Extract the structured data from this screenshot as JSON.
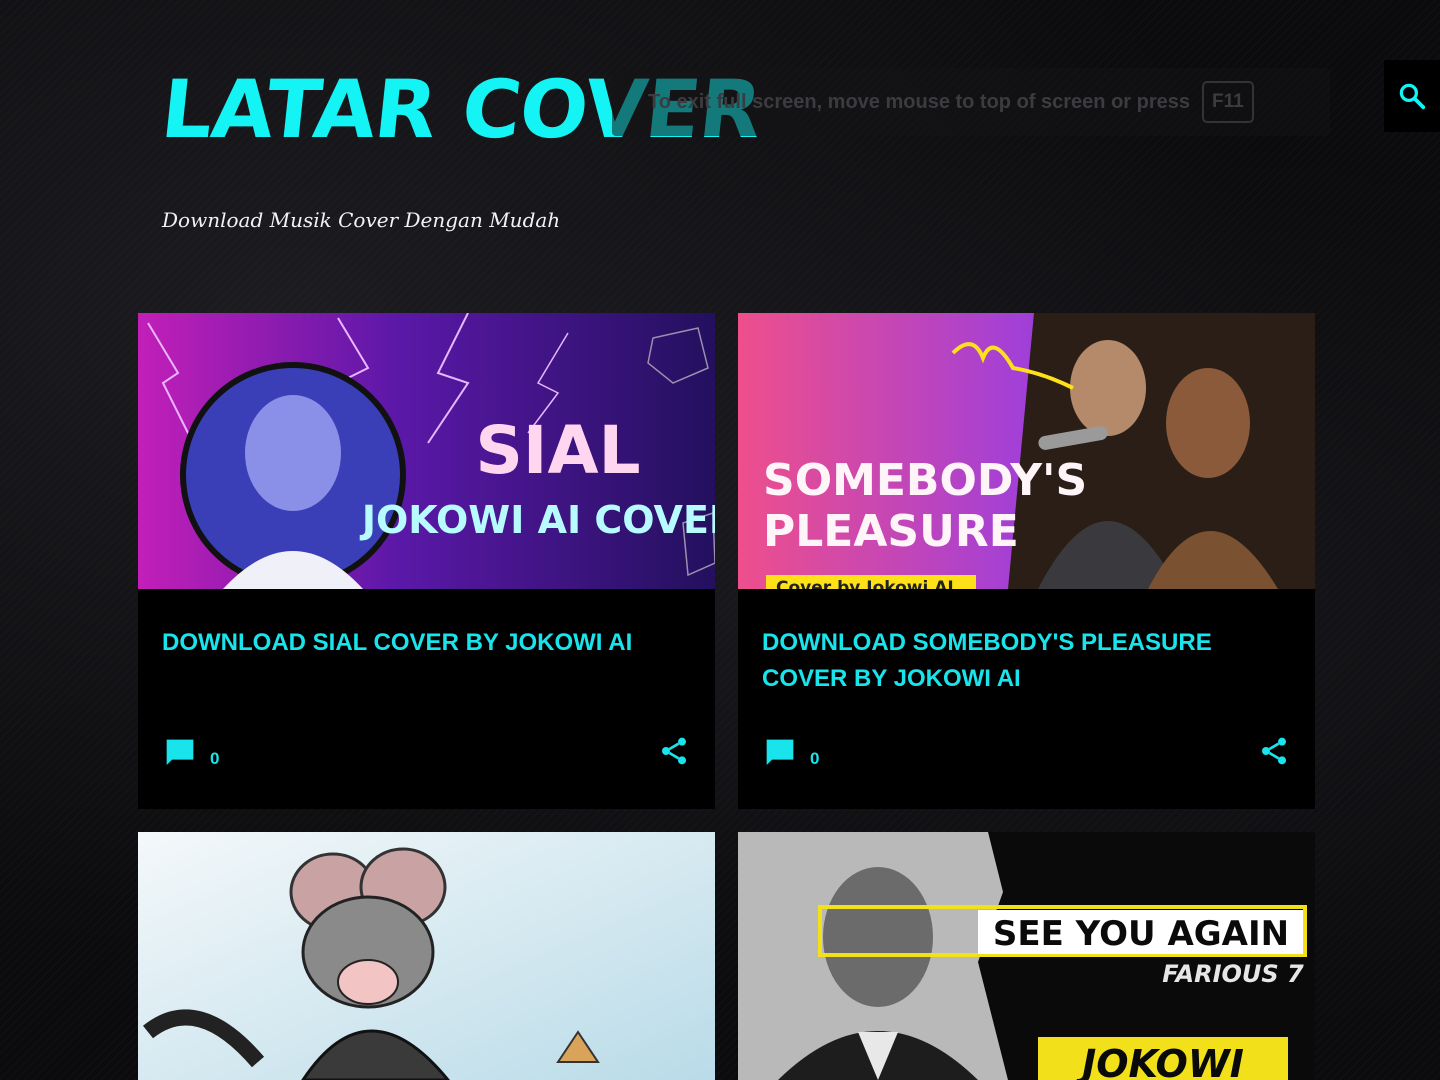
{
  "blog": {
    "title": "LATAR COVER",
    "description": "Download Musik Cover Dengan Mudah"
  },
  "fullscreen_toast": {
    "message": "To exit full screen, move mouse to top of screen or press",
    "key": "F11"
  },
  "colors": {
    "accent": "#14f4f4",
    "background": "#0b0b0d",
    "card": "#000000"
  },
  "posts": [
    {
      "title": "DOWNLOAD SIAL COVER BY JOKOWI AI",
      "comments": "0",
      "thumb_text": [
        "SIAL",
        "JOKOWI AI COVER"
      ]
    },
    {
      "title": "DOWNLOAD SOMEBODY'S PLEASURE COVER BY JOKOWI AI",
      "comments": "0",
      "thumb_text": [
        "SOMEBODY'S",
        "PLEASURE",
        "Cover by Jokowi AI"
      ]
    },
    {
      "thumb_text": []
    },
    {
      "thumb_text": [
        "SEE YOU AGAIN",
        "FARIOUS 7",
        "JOKOWI"
      ]
    }
  ],
  "icons": {
    "search": "search-icon",
    "comment": "comment-icon",
    "share": "share-icon"
  }
}
